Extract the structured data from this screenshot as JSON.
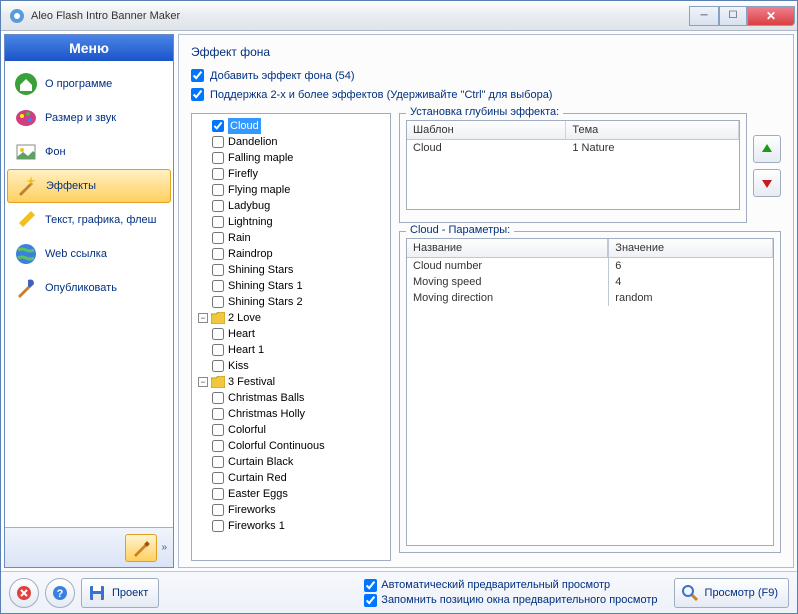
{
  "window": {
    "title": "Aleo Flash Intro Banner Maker"
  },
  "menu": {
    "header": "Меню",
    "items": [
      {
        "label": "О программе",
        "icon": "home-icon"
      },
      {
        "label": "Размер и звук",
        "icon": "palette-icon"
      },
      {
        "label": "Фон",
        "icon": "image-icon"
      },
      {
        "label": "Эффекты",
        "icon": "wand-icon",
        "selected": true
      },
      {
        "label": "Текст, графика, флеш",
        "icon": "pencil-icon"
      },
      {
        "label": "Web ссылка",
        "icon": "globe-icon"
      },
      {
        "label": "Опубликовать",
        "icon": "brush-icon"
      }
    ]
  },
  "main": {
    "section_title": "Эффект фона",
    "chk1": "Добавить эффект фона (54)",
    "chk2": "Поддержка 2-х и более эффектов (Удерживайте \"Ctrl\" для выбора)"
  },
  "tree": {
    "groups": [
      {
        "name": "2 Love",
        "items": [
          "Heart",
          "Heart 1",
          "Kiss"
        ]
      },
      {
        "name": "3 Festival",
        "items": [
          "Christmas Balls",
          "Christmas Holly",
          "Colorful",
          "Colorful Continuous",
          "Curtain Black",
          "Curtain Red",
          "Easter Eggs",
          "Fireworks",
          "Fireworks 1"
        ]
      }
    ],
    "first_group_items": [
      "Cloud",
      "Dandelion",
      "Falling maple",
      "Firefly",
      "Flying maple",
      "Ladybug",
      "Lightning",
      "Rain",
      "Raindrop",
      "Shining Stars",
      "Shining Stars 1",
      "Shining Stars 2"
    ],
    "selected": "Cloud"
  },
  "depth": {
    "legend": "Установка глубины эффекта:",
    "headers": [
      "Шаблон",
      "Тема"
    ],
    "row": [
      "Cloud",
      "1 Nature"
    ]
  },
  "params": {
    "legend": "Cloud - Параметры:",
    "headers": [
      "Название",
      "Значение"
    ],
    "rows": [
      [
        "Cloud number",
        "6"
      ],
      [
        "Moving speed",
        "4"
      ],
      [
        "Moving direction",
        "random"
      ]
    ]
  },
  "bottombar": {
    "project": "Проект",
    "auto_preview": "Автоматический предварительный просмотр",
    "remember_pos": "Запомнить позицию окна предварительного просмотр",
    "preview": "Просмотр (F9)"
  }
}
